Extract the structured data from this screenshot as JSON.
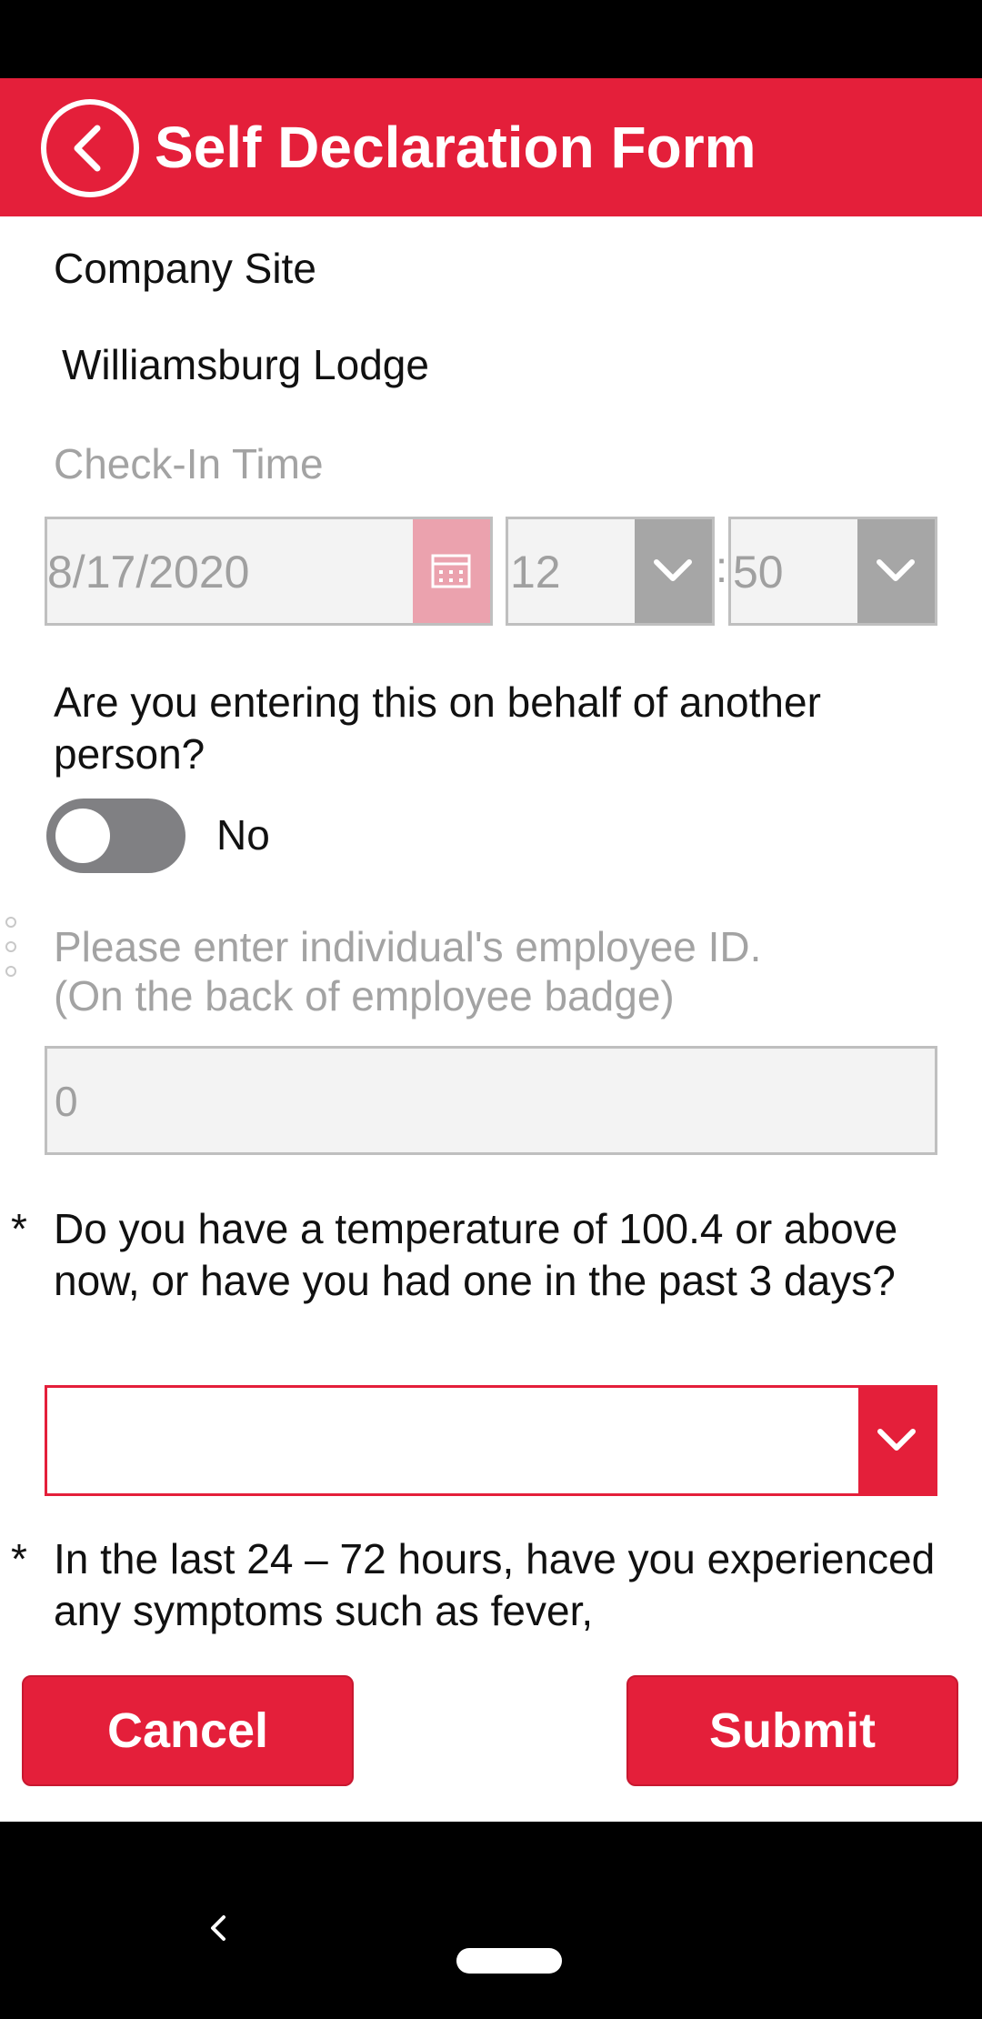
{
  "header": {
    "title": "Self Declaration Form",
    "back_icon": "chevron-left-circle-icon"
  },
  "form": {
    "site": {
      "label": "Company Site",
      "value": "Williamsburg Lodge"
    },
    "checkin": {
      "label": "Check-In Time",
      "date": "8/17/2020",
      "hour": "12",
      "separator": ":",
      "minute": "50"
    },
    "behalf": {
      "question": "Are you entering this on behalf of another person?",
      "toggle_label": "No",
      "toggle_on": false
    },
    "employee_id": {
      "label_line1": "Please enter individual's employee ID.",
      "label_line2": "(On the back of employee badge)",
      "value": "0"
    },
    "temperature": {
      "required_mark": "*",
      "question": "Do you have a temperature of 100.4 or above now, or have you had one in the past 3 days?",
      "selected": ""
    },
    "symptoms": {
      "required_mark": "*",
      "question": "In the last 24 – 72 hours, have you experienced any symptoms such as fever,"
    }
  },
  "footer": {
    "cancel_label": "Cancel",
    "submit_label": "Submit"
  },
  "colors": {
    "accent": "#e41f3a",
    "disabled_bg": "#f3f3f3",
    "toggle_off": "#808083"
  }
}
